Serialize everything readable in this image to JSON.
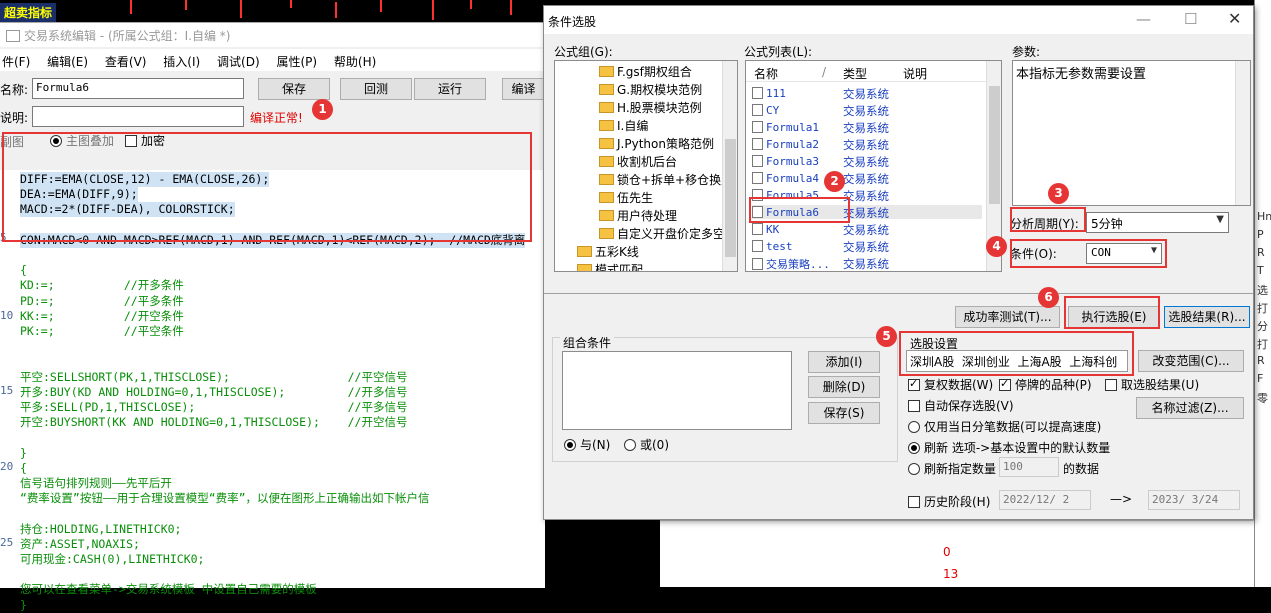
{
  "background": {
    "chart_title": "超卖指标",
    "right_strip_chars": [
      "Hn",
      "P",
      "R",
      "T",
      "选",
      "打",
      "分",
      "打",
      "R",
      "F",
      "零"
    ],
    "bottom_chart_numbers": [
      "0",
      "13"
    ]
  },
  "editor": {
    "title": "交易系统编辑 - (所属公式组：I.自编 *)",
    "menu": [
      "件(F)",
      "编辑(E)",
      "查看(V)",
      "插入(I)",
      "调试(D)",
      "属性(P)",
      "帮助(H)"
    ],
    "name_label": "名称:",
    "name_value": "Formula6",
    "desc_label": "说明:",
    "desc_value": "",
    "save_btn": "保存",
    "cancel_btn": "回测",
    "run_btn": "运行",
    "compile_btn": "编译",
    "status": "编译正常!",
    "opt_subchart": "副图",
    "opt_main_overlay": "主图叠加",
    "opt_encrypt": "加密",
    "gutter_numbers": [
      "5",
      "10",
      "15",
      "20",
      "25"
    ],
    "code_lines": [
      "DIFF:=EMA(CLOSE,12) - EMA(CLOSE,26);",
      "DEA:=EMA(DIFF,9);",
      "MACD:=2*(DIFF-DEA), COLORSTICK;",
      "",
      "CON:MACD<0 AND MACD>REF(MACD,1) AND REF(MACD,1)<REF(MACD,2);  //MACD底背离",
      "",
      "{",
      "KD:=;          //开多条件",
      "PD:=;          //平多条件",
      "KK:=;          //开空条件",
      "PK:=;          //平空条件",
      "",
      "",
      "平空:SELLSHORT(PK,1,THISCLOSE);                 //平空信号",
      "开多:BUY(KD AND HOLDING=0,1,THISCLOSE);         //开多信号",
      "平多:SELL(PD,1,THISCLOSE);                      //平多信号",
      "开空:BUYSHORT(KK AND HOLDING=0,1,THISCLOSE);    //开空信号",
      "",
      "}",
      "{",
      "信号语句排列规则——先平后开",
      "“费率设置”按钮——用于合理设置模型“费率”，以便在图形上正确输出如下帐户信",
      "",
      "持仓:HOLDING,LINETHICK0;",
      "资产:ASSET,NOAXIS;",
      "可用现金:CASH(0),LINETHICK0;",
      "",
      "您可以在查看菜单->交易系统模板 中设置自己需要的模板",
      "}"
    ]
  },
  "dialog": {
    "title": "条件选股",
    "formula_group_label": "公式组(G):",
    "formula_list_label": "公式列表(L):",
    "params_label": "参数:",
    "params_text": "本指标无参数需要设置",
    "tree_items": [
      "F.gsf期权组合",
      "G.期权模块范例",
      "H.股票模块范例",
      "I.自编",
      "J.Python策略范例",
      "收割机后台",
      "锁仓+拆单+移仓换月",
      "伍先生",
      "用户待处理",
      "自定义开盘价定多空",
      "五彩K线",
      "模式匹配"
    ],
    "list_headers": [
      "名称",
      "/",
      "类型",
      "说明"
    ],
    "list_items": [
      {
        "name": "111",
        "type": "交易系统"
      },
      {
        "name": "CY",
        "type": "交易系统"
      },
      {
        "name": "Formula1",
        "type": "交易系统"
      },
      {
        "name": "Formula2",
        "type": "交易系统"
      },
      {
        "name": "Formula3",
        "type": "交易系统"
      },
      {
        "name": "Formula4",
        "type": "交易系统"
      },
      {
        "name": "Formula5",
        "type": "交易系统"
      },
      {
        "name": "Formula6",
        "type": "交易系统"
      },
      {
        "name": "KK",
        "type": "交易系统"
      },
      {
        "name": "test",
        "type": "交易系统"
      },
      {
        "name": "交易策略...",
        "type": "交易系统"
      }
    ],
    "period_label": "分析周期(Y):",
    "period_value": "5分钟",
    "condition_label": "条件(O):",
    "condition_value": "CON",
    "success_test_btn": "成功率测试(T)...",
    "execute_btn": "执行选股(E)",
    "result_btn": "选股结果(R)...",
    "combo_label": "组合条件",
    "add_btn": "添加(I)",
    "delete_btn": "删除(D)",
    "save_btn": "保存(S)",
    "and_label": "与(N)",
    "or_label": "或(0)",
    "settings_label": "选股设置",
    "markets": "深圳A股  深圳创业  上海A股  上海科创",
    "change_range_btn": "改变范围(C)...",
    "chk_adjust": "复权数据(W)",
    "chk_suspended": "停牌的品种(P)",
    "chk_negate": "取选股结果(U)",
    "chk_autosave": "自动保存选股(V)",
    "name_filter_btn": "名称过滤(Z)...",
    "radio_today": "仅用当日分笔数据(可以提高速度)",
    "radio_default": "刷新 选项->基本设置中的默认数量",
    "radio_custom": "刷新指定数量",
    "custom_count": "100",
    "custom_suffix": "的数据",
    "history_label": "历史阶段(H)",
    "date_from": "2022/12/ 2",
    "date_arrow": "—>",
    "date_to": "2023/ 3/24"
  },
  "annotations": [
    "1",
    "2",
    "3",
    "4",
    "5",
    "6"
  ],
  "colors": {
    "annotation_red": "#e53535",
    "code_green": "#0a8f0a",
    "list_blue": "#1a3fc0"
  }
}
